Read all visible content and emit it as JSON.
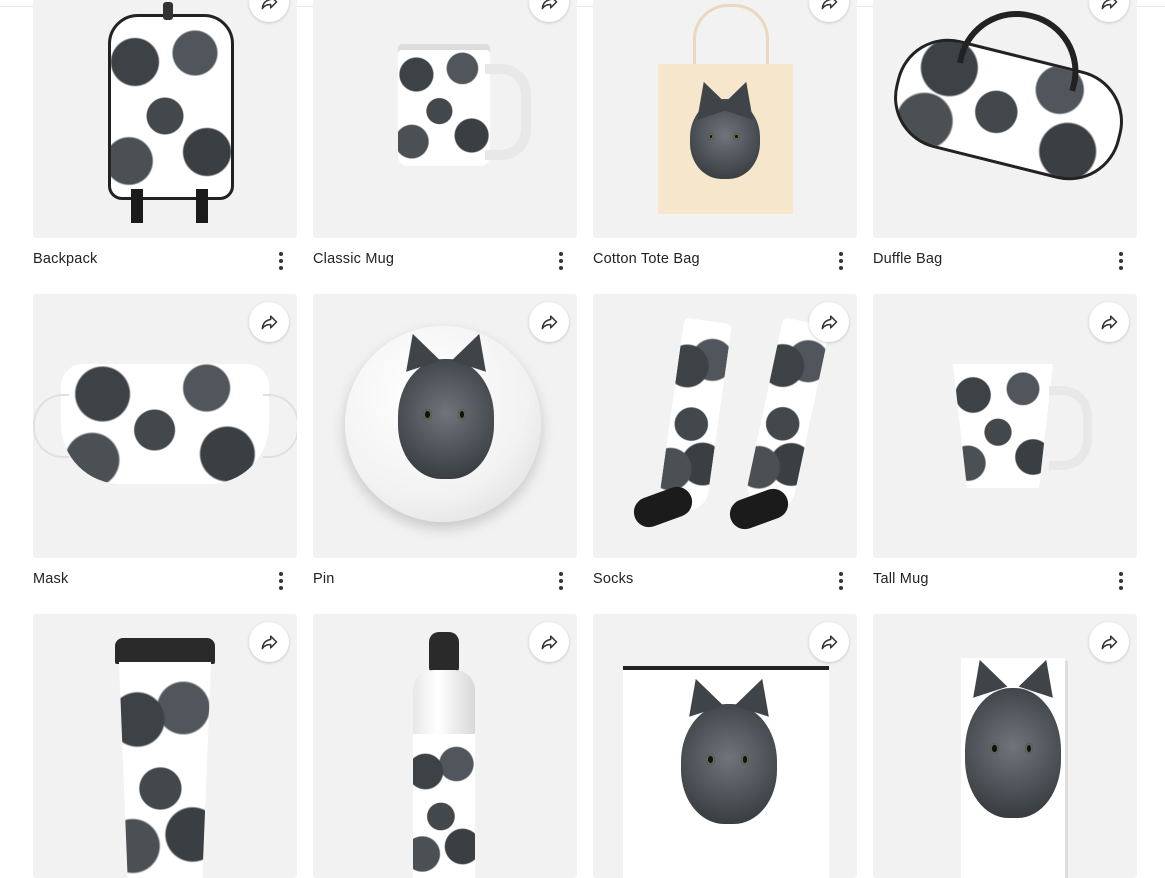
{
  "products": [
    {
      "name": "Backpack"
    },
    {
      "name": "Classic Mug"
    },
    {
      "name": "Cotton Tote Bag"
    },
    {
      "name": "Duffle Bag"
    },
    {
      "name": "Mask"
    },
    {
      "name": "Pin"
    },
    {
      "name": "Socks"
    },
    {
      "name": "Tall Mug"
    },
    {
      "name": ""
    },
    {
      "name": ""
    },
    {
      "name": ""
    },
    {
      "name": ""
    }
  ],
  "icons": {
    "share": "share-arrow-icon",
    "more": "more-vertical-icon"
  },
  "colors": {
    "card_bg": "#f2f2f2",
    "text": "#222222"
  }
}
